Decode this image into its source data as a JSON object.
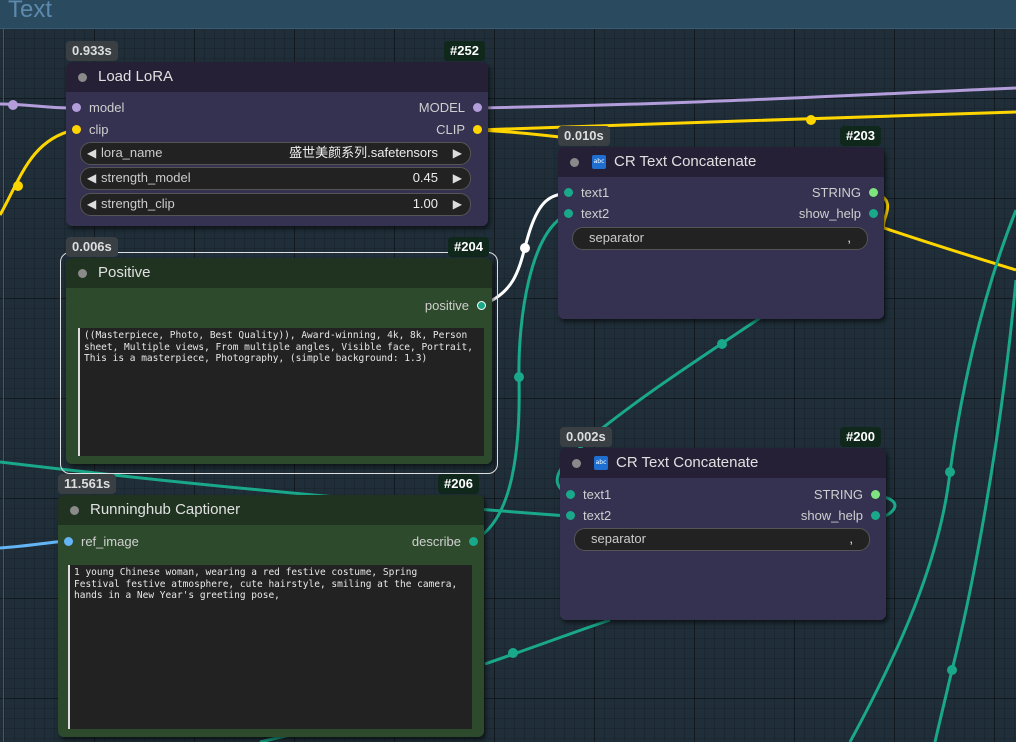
{
  "group": {
    "title": "Text"
  },
  "nodes": {
    "load_lora": {
      "time": "0.933s",
      "id": "#252",
      "title": "Load LoRA",
      "inputs": [
        "model",
        "clip"
      ],
      "outputs": [
        "MODEL",
        "CLIP"
      ],
      "widgets": [
        {
          "label": "lora_name",
          "value": "盛世美颜系列.safetensors"
        },
        {
          "label": "strength_model",
          "value": "0.45"
        },
        {
          "label": "strength_clip",
          "value": "1.00"
        }
      ]
    },
    "positive": {
      "time": "0.006s",
      "id": "#204",
      "title": "Positive",
      "output": "positive",
      "text": "((Masterpiece, Photo, Best Quality)), Award-winning, 4k, 8k, Person sheet, Multiple views, From multiple angles, Visible face, Portrait, This is a masterpiece, Photography, (simple background: 1.3)"
    },
    "captioner": {
      "time": "11.561s",
      "id": "#206",
      "title": "Runninghub Captioner",
      "input": "ref_image",
      "output": "describe",
      "text": "1 young Chinese woman, wearing a red festive costume, Spring Festival festive atmosphere, cute hairstyle, smiling at the camera, hands in a New Year's greeting pose,"
    },
    "concat_203": {
      "time": "0.010s",
      "id": "#203",
      "title": "CR Text Concatenate",
      "icon": "abc",
      "inputs": [
        "text1",
        "text2"
      ],
      "outputs": [
        "STRING",
        "show_help"
      ],
      "separator_label": "separator",
      "separator_value": ","
    },
    "concat_200": {
      "time": "0.002s",
      "id": "#200",
      "title": "CR Text Concatenate",
      "icon": "abc",
      "inputs": [
        "text1",
        "text2"
      ],
      "outputs": [
        "STRING",
        "show_help"
      ],
      "separator_label": "separator",
      "separator_value": ","
    }
  },
  "colors": {
    "model": "#b39ddb",
    "clip": "#ffd500",
    "string": "#1aa88a",
    "image": "#64b5f6",
    "lora_node": "#353150",
    "text_node": "#2d4a2d"
  },
  "icons": {
    "arrow_left": "◀",
    "arrow_right": "▶",
    "node_status": "circle-dot-icon"
  }
}
